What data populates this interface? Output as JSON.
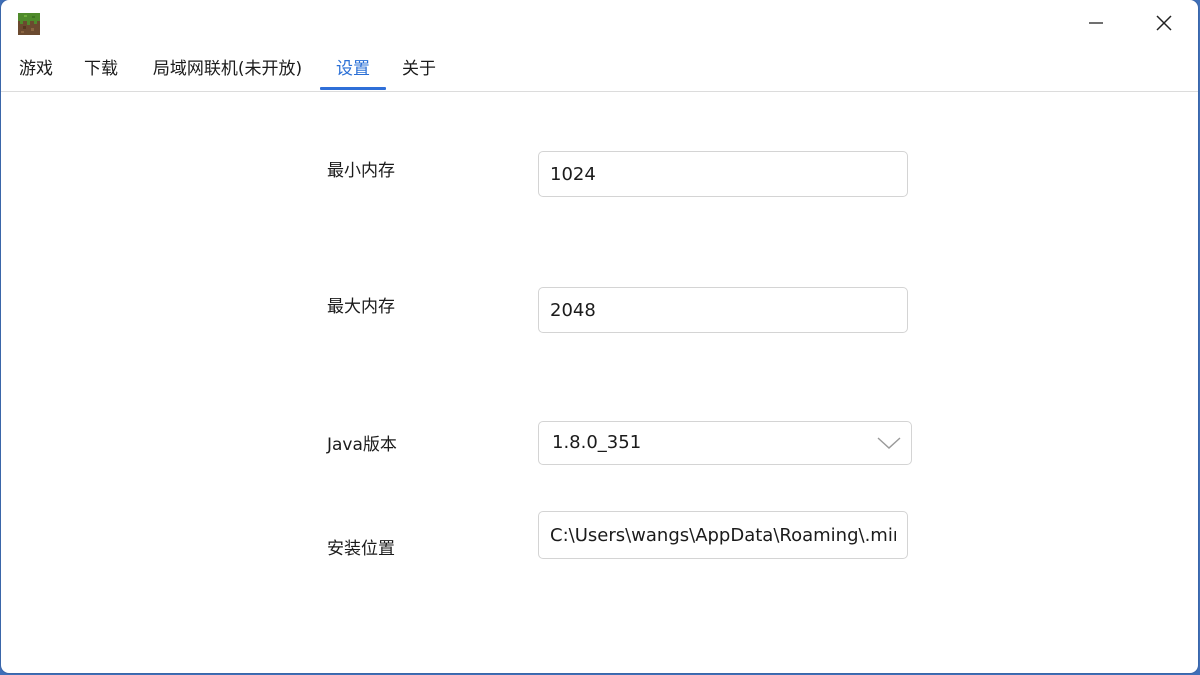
{
  "window": {
    "icon": "grass-block-icon",
    "controls": {
      "minimize_icon": "minimize-icon",
      "close_icon": "close-icon"
    }
  },
  "tabs": [
    {
      "label": "游戏"
    },
    {
      "label": "下载"
    },
    {
      "label": "局域网联机(未开放)"
    },
    {
      "label": "设置",
      "active": true
    },
    {
      "label": "关于"
    }
  ],
  "settings": {
    "min_memory": {
      "label": "最小内存",
      "value": "1024"
    },
    "max_memory": {
      "label": "最大内存",
      "value": "2048"
    },
    "java_version": {
      "label": "Java版本",
      "selected": "1.8.0_351",
      "icon": "chevron-down-icon"
    },
    "install_path": {
      "label": "安装位置",
      "value": "C:\\Users\\wangs\\AppData\\Roaming\\.minecraft"
    }
  },
  "colors": {
    "accent": "#2f6fd8",
    "background": "#3f6fb8"
  }
}
